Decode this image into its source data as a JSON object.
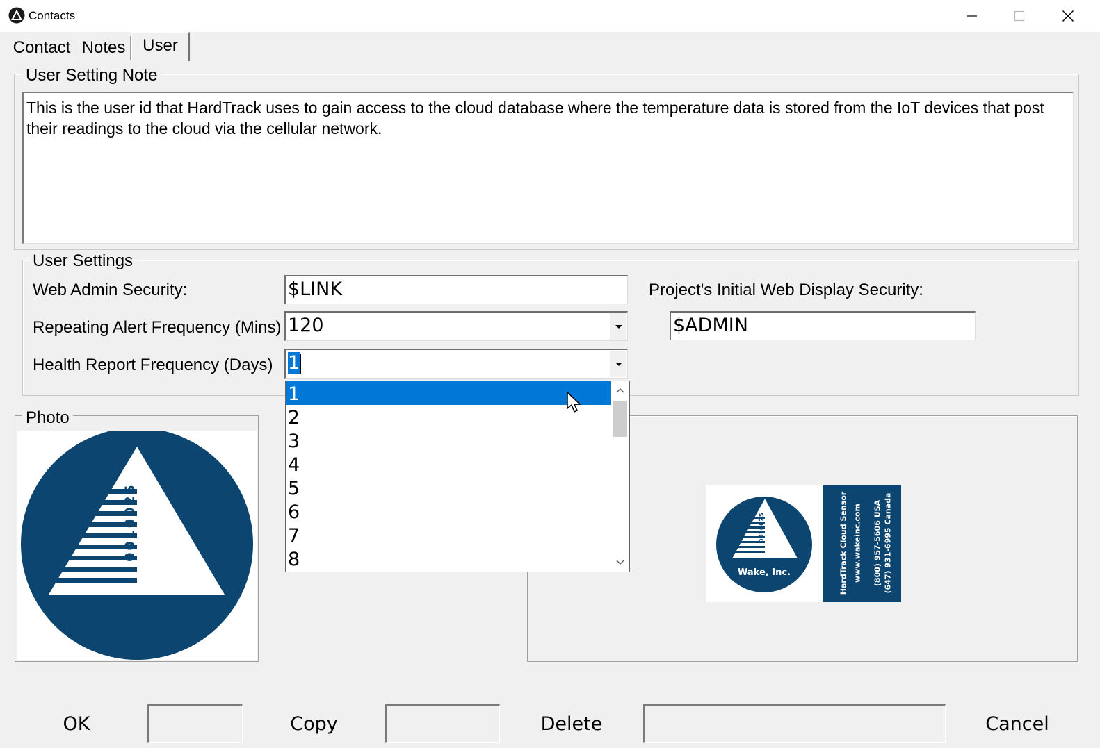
{
  "window": {
    "title": "Contacts",
    "controls": {
      "minimize": "minimize-icon",
      "maximize": "maximize-icon",
      "close": "close-icon"
    }
  },
  "tabs": [
    {
      "label": "Contact",
      "active": false
    },
    {
      "label": "Notes",
      "active": false
    },
    {
      "label": "User",
      "active": true
    }
  ],
  "note_group": {
    "legend": "User Setting Note",
    "text": "This is the user id that HardTrack uses to gain access to the cloud database where the temperature data is stored from the IoT devices that post their readings to the cloud via the cellular network."
  },
  "settings_group": {
    "legend": "User Settings",
    "web_admin_label": "Web Admin Security:",
    "web_admin_value": "$LINK",
    "repeat_label": "Repeating Alert Frequency (Mins)",
    "repeat_value": "120",
    "health_label": "Health Report Frequency (Days)",
    "health_value": "1",
    "project_label": "Project's Initial Web Display Security:",
    "project_value": "$ADMIN"
  },
  "health_dropdown": {
    "options": [
      "1",
      "2",
      "3",
      "4",
      "5",
      "6",
      "7",
      "8"
    ],
    "selected": "1"
  },
  "photo": {
    "legend": "Photo",
    "logo_digits": "0010025"
  },
  "label_card": {
    "logo_digits": "0010025",
    "company": "Wake, Inc.",
    "product": "HardTrack Cloud Sensor",
    "website": "www.wakeinc.com",
    "phone_usa": "(800) 957-5606 USA",
    "phone_canada": "(647) 931-6995 Canada"
  },
  "buttons": {
    "ok": "OK",
    "copy": "Copy",
    "delete": "Delete",
    "cancel": "Cancel"
  },
  "colors": {
    "brand_navy": "#0b4570",
    "selection": "#0078d7",
    "window_bg": "#f0f0f0"
  }
}
